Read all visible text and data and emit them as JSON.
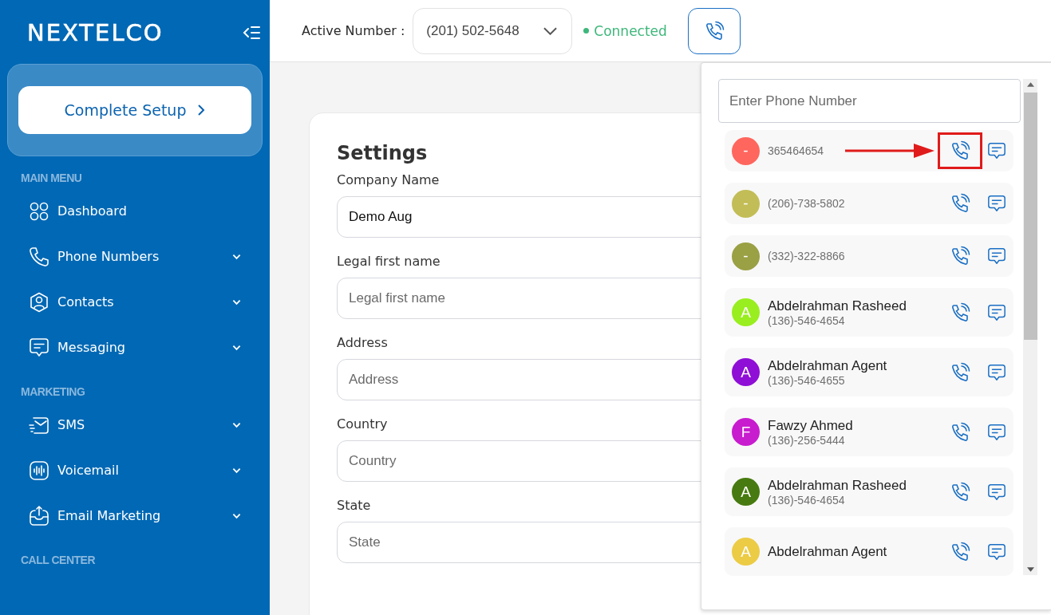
{
  "sidebar": {
    "logo": "NEXTELCO",
    "setup_button": "Complete Setup",
    "sections": [
      {
        "heading": "MAIN MENU",
        "items": [
          {
            "label": "Dashboard",
            "expandable": false
          },
          {
            "label": "Phone Numbers",
            "expandable": true
          },
          {
            "label": "Contacts",
            "expandable": true
          },
          {
            "label": "Messaging",
            "expandable": true
          }
        ]
      },
      {
        "heading": "MARKETING",
        "items": [
          {
            "label": "SMS",
            "expandable": true
          },
          {
            "label": "Voicemail",
            "expandable": true
          },
          {
            "label": "Email Marketing",
            "expandable": true
          }
        ]
      },
      {
        "heading": "CALL CENTER"
      }
    ]
  },
  "header": {
    "active_label": "Active Number :",
    "active_number": "(201) 502-5648",
    "status": "Connected",
    "connected": true
  },
  "settings": {
    "title": "Settings",
    "fields": [
      {
        "label": "Company Name",
        "value": "Demo Aug"
      },
      {
        "label": "Legal first name",
        "placeholder": "Legal first name"
      },
      {
        "label": "Address",
        "placeholder": "Address"
      },
      {
        "label": "Country",
        "placeholder": "Country"
      },
      {
        "label": "State",
        "placeholder": "State"
      }
    ]
  },
  "dialer": {
    "placeholder": "Enter Phone Number",
    "contacts": [
      {
        "kind": "number",
        "initial": "-",
        "phone": "365464654",
        "color": "#ff665e",
        "highlighted": true
      },
      {
        "kind": "number",
        "initial": "-",
        "phone": "(206)-738-5802",
        "color": "#c2bd56",
        "highlighted": false
      },
      {
        "kind": "number",
        "initial": "-",
        "phone": "(332)-322-8866",
        "color": "#9aa044",
        "highlighted": false
      },
      {
        "kind": "named",
        "initial": "A",
        "name": "Abdelrahman Rasheed",
        "phone": "(136)-546-4654",
        "color": "#99ee1f",
        "highlighted": false
      },
      {
        "kind": "named",
        "initial": "A",
        "name": "Abdelrahman Agent",
        "phone": "(136)-546-4655",
        "color": "#8f0fd6",
        "highlighted": false
      },
      {
        "kind": "named",
        "initial": "F",
        "name": "Fawzy Ahmed",
        "phone": "(136)-256-5444",
        "color": "#c81ccf",
        "highlighted": false
      },
      {
        "kind": "named",
        "initial": "A",
        "name": "Abdelrahman Rasheed",
        "phone": "(136)-546-4654",
        "color": "#477a10",
        "highlighted": false
      },
      {
        "kind": "named",
        "initial": "A",
        "name": "Abdelrahman Agent",
        "color": "#eccb45",
        "highlighted": false
      }
    ]
  }
}
